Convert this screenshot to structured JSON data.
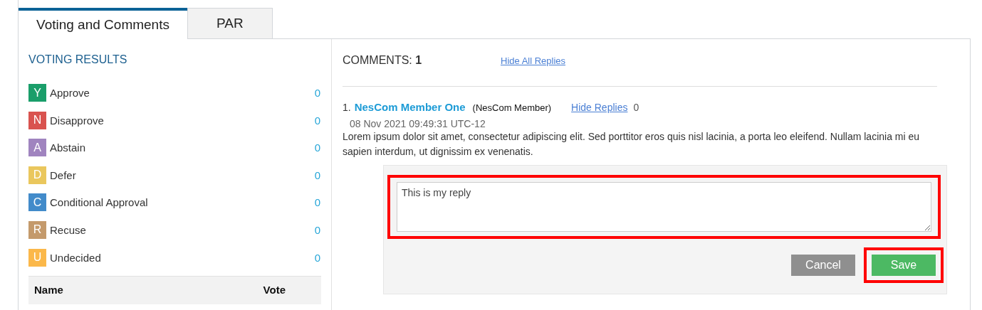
{
  "tabs": [
    {
      "label": "Voting and Comments",
      "selected": true
    },
    {
      "label": "PAR",
      "selected": false
    }
  ],
  "voting_results": {
    "title": "VOTING RESULTS",
    "options": [
      {
        "letter": "Y",
        "label": "Approve",
        "count": "0",
        "color": "#1a9e6a"
      },
      {
        "letter": "N",
        "label": "Disapprove",
        "count": "0",
        "color": "#d9534f"
      },
      {
        "letter": "A",
        "label": "Abstain",
        "count": "0",
        "color": "#a084bf"
      },
      {
        "letter": "D",
        "label": "Defer",
        "count": "0",
        "color": "#eac75d"
      },
      {
        "letter": "C",
        "label": "Conditional Approval",
        "count": "0",
        "color": "#428bca"
      },
      {
        "letter": "R",
        "label": "Recuse",
        "count": "0",
        "color": "#c49a6c"
      },
      {
        "letter": "U",
        "label": "Undecided",
        "count": "0",
        "color": "#fbb84a"
      }
    ],
    "table": {
      "columns": [
        "Name",
        "Vote"
      ]
    }
  },
  "comments": {
    "label": "COMMENTS:",
    "count": "1",
    "hide_all_link": "Hide All Replies",
    "items": [
      {
        "number": "1.",
        "author": "NesCom Member One",
        "role": "(NesCom Member)",
        "hide_link": "Hide Replies",
        "reply_count": "0",
        "timestamp": "08 Nov 2021 09:49:31 UTC-12",
        "text": "Lorem ipsum dolor sit amet, consectetur adipiscing elit. Sed porttitor eros quis nisl lacinia, a porta leo eleifend. Nullam lacinia mi eu sapien interdum, ut dignissim ex venenatis."
      }
    ],
    "reply_form": {
      "value": "This is my reply",
      "highlighted": true,
      "buttons": [
        {
          "label": "Cancel",
          "kind": "cancel",
          "highlighted": false
        },
        {
          "label": "Save",
          "kind": "save",
          "highlighted": true
        }
      ]
    }
  }
}
